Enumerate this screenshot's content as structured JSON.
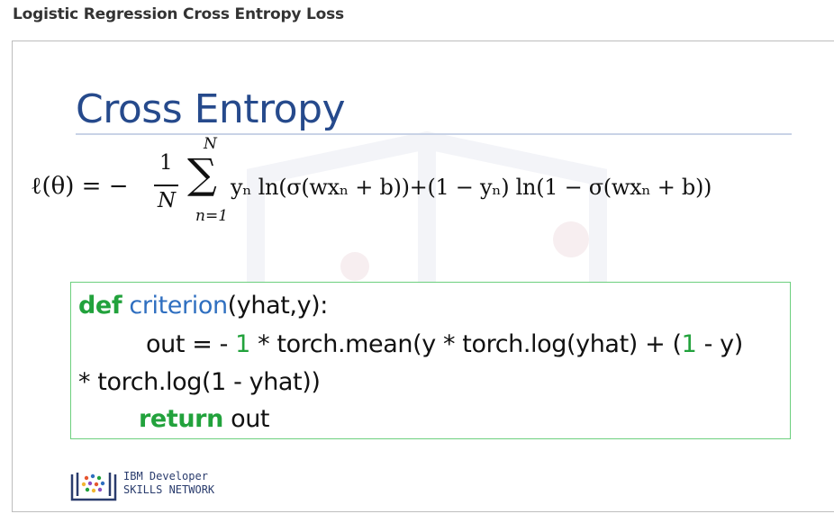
{
  "page": {
    "heading": "Logistic Regression Cross Entropy Loss"
  },
  "slide": {
    "title": "Cross Entropy",
    "formula": {
      "lhs": "ℓ(θ) = −",
      "frac_num": "1",
      "frac_den": "N",
      "sum_symbol": "∑",
      "sum_upper": "N",
      "sum_lower": "n=1",
      "body": "yₙ ln(σ(wxₙ + b))+(1 − yₙ) ln(1 − σ(wxₙ + b))"
    },
    "code": {
      "line1": {
        "kw": "def",
        "fn": "criterion",
        "rest": "(yhat,y):"
      },
      "line2": {
        "a": "out = - ",
        "n1": "1",
        "b": " * torch.mean(y * torch.log(yhat) + (",
        "n2": "1",
        "c": " - y)"
      },
      "line3": "* torch.log(1 - yhat))",
      "line4": {
        "kw": "return",
        "rest": " out"
      }
    },
    "brand": {
      "line1": "IBM Developer",
      "line2": "SKILLS NETWORK"
    }
  },
  "colors": {
    "title": "#264a8c",
    "keyword": "#22a23c",
    "function": "#2f6fc0",
    "box_border": "#6ccf7e"
  }
}
